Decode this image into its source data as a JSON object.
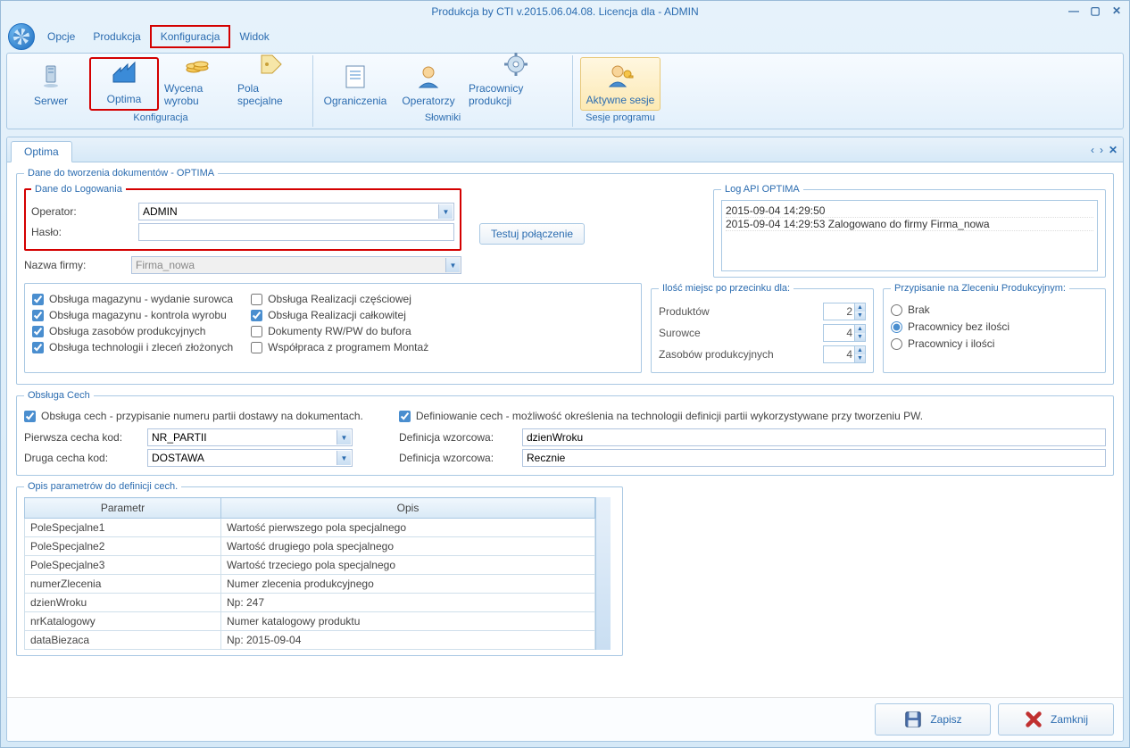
{
  "window_title": "Produkcja by CTI v.2015.06.04.08. Licencja dla  - ADMIN",
  "menu": {
    "opcje": "Opcje",
    "produkcja": "Produkcja",
    "konfiguracja": "Konfiguracja",
    "widok": "Widok"
  },
  "ribbon": {
    "group1_label": "Konfiguracja",
    "group2_label": "Słowniki",
    "group3_label": "Sesje programu",
    "btn_serwer": "Serwer",
    "btn_optima": "Optima",
    "btn_wycena": "Wycena wyrobu",
    "btn_pola": "Pola specjalne",
    "btn_ograniczenia": "Ograniczenia",
    "btn_operatorzy": "Operatorzy",
    "btn_pracownicy": "Pracownicy produkcji",
    "btn_sesje": "Aktywne sesje"
  },
  "tab_name": "Optima",
  "fs_dane_dok": "Dane do tworzenia dokumentów - OPTIMA",
  "fs_login": "Dane do Logowania",
  "lbl_operator": "Operator:",
  "val_operator": "ADMIN",
  "lbl_haslo": "Hasło:",
  "lbl_nazwa_firmy": "Nazwa firmy:",
  "val_nazwa_firmy": "Firma_nowa",
  "btn_testuj": "Testuj połączenie",
  "fs_log": "Log API OPTIMA",
  "log_lines": {
    "l1": "2015-09-04 14:29:50",
    "l2": "2015-09-04 14:29:53 Zalogowano do firmy Firma_nowa"
  },
  "chk": {
    "c1": "Obsługa magazynu - wydanie surowca",
    "c2": "Obsługa magazynu - kontrola wyrobu",
    "c3": "Obsługa zasobów produkcyjnych",
    "c4": "Obsługa technologii i zleceń złożonych",
    "c5": "Obsługa Realizacji częściowej",
    "c6": "Obsługa Realizacji całkowitej",
    "c7": "Dokumenty RW/PW do bufora",
    "c8": "Współpraca z programem Montaż"
  },
  "fs_ilosc": "Ilość miejsc po przecinku dla:",
  "ilosc": {
    "produktow_lbl": "Produktów",
    "produktow_val": "2",
    "surowce_lbl": "Surowce",
    "surowce_val": "4",
    "zasobow_lbl": "Zasobów produkcyjnych",
    "zasobow_val": "4"
  },
  "fs_przypisanie": "Przypisanie na Zleceniu Produkcyjnym:",
  "radio": {
    "r1": "Brak",
    "r2": "Pracownicy bez ilości",
    "r3": "Pracownicy i ilości"
  },
  "fs_cech": "Obsługa Cech",
  "cech": {
    "chk1": "Obsługa cech - przypisanie numeru partii dostawy na dokumentach.",
    "chk2": "Definiowanie cech - możliwość określenia na technologii definicji partii wykorzystywane przy tworzeniu PW.",
    "lbl_pierwsza": "Pierwsza cecha kod:",
    "val_pierwsza": "NR_PARTII",
    "lbl_druga": "Druga cecha kod:",
    "val_druga": "DOSTAWA",
    "lbl_def1": "Definicja wzorcowa:",
    "val_def1": "dzienWroku",
    "lbl_def2": "Definicja wzorcowa:",
    "val_def2": "Recznie"
  },
  "fs_opis": "Opis parametrów do definicji cech.",
  "table": {
    "h1": "Parametr",
    "h2": "Opis",
    "rows": {
      "r0p": "PoleSpecjalne1",
      "r0o": "Wartość pierwszego pola specjalnego",
      "r1p": "PoleSpecjalne2",
      "r1o": "Wartość drugiego pola specjalnego",
      "r2p": "PoleSpecjalne3",
      "r2o": "Wartość trzeciego pola specjalnego",
      "r3p": "numerZlecenia",
      "r3o": "Numer zlecenia produkcyjnego",
      "r4p": "dzienWroku",
      "r4o": "Np: 247",
      "r5p": "nrKatalogowy",
      "r5o": "Numer katalogowy produktu",
      "r6p": "dataBiezaca",
      "r6o": "Np: 2015-09-04"
    }
  },
  "footer": {
    "zapisz": "Zapisz",
    "zamknij": "Zamknij"
  }
}
